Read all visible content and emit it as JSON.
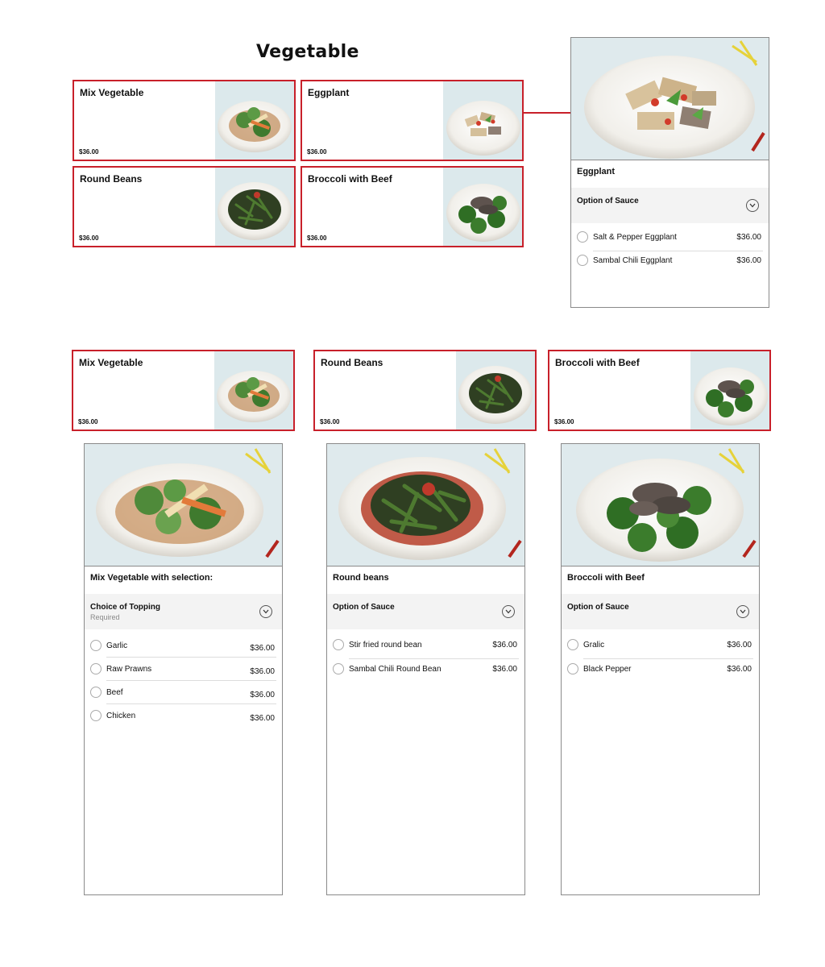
{
  "section": {
    "title": "Vegetable"
  },
  "top_cards": [
    {
      "name": "Mix Vegetable",
      "price": "$36.00"
    },
    {
      "name": "Eggplant",
      "price": "$36.00"
    },
    {
      "name": "Round Beans",
      "price": "$36.00"
    },
    {
      "name": "Broccoli with Beef",
      "price": "$36.00"
    }
  ],
  "eggplant_panel": {
    "title": "Eggplant",
    "option_label": "Option of Sauce",
    "choices": [
      {
        "label": "Salt & Pepper Eggplant",
        "price": "$36.00"
      },
      {
        "label": "Sambal Chili Eggplant",
        "price": "$36.00"
      }
    ]
  },
  "bottom_cards": [
    {
      "name": "Mix Vegetable",
      "price": "$36.00"
    },
    {
      "name": "Round Beans",
      "price": "$36.00"
    },
    {
      "name": "Broccoli with Beef",
      "price": "$36.00"
    }
  ],
  "panels": [
    {
      "title": "Mix Vegetable with selection:",
      "option_label": "Choice of Topping",
      "option_sub": "Required",
      "choices": [
        {
          "label": "Garlic",
          "price": "$36.00"
        },
        {
          "label": "Raw Prawns",
          "price": "$36.00"
        },
        {
          "label": "Beef",
          "price": "$36.00"
        },
        {
          "label": "Chicken",
          "price": "$36.00"
        }
      ]
    },
    {
      "title": "Round beans",
      "option_label": "Option of Sauce",
      "choices": [
        {
          "label": "Stir fried round bean",
          "price": "$36.00"
        },
        {
          "label": "Sambal Chili Round Bean",
          "price": "$36.00"
        }
      ]
    },
    {
      "title": "Broccoli with Beef",
      "option_label": "Option of Sauce",
      "choices": [
        {
          "label": "Gralic",
          "price": "$36.00"
        },
        {
          "label": "Black Pepper",
          "price": "$36.00"
        }
      ]
    }
  ],
  "colors": {
    "accent": "#c8202a",
    "panel_border": "#8a8a8a",
    "option_bg": "#f3f3f3"
  },
  "icons": [
    "chevron-down-icon",
    "radio-icon"
  ]
}
